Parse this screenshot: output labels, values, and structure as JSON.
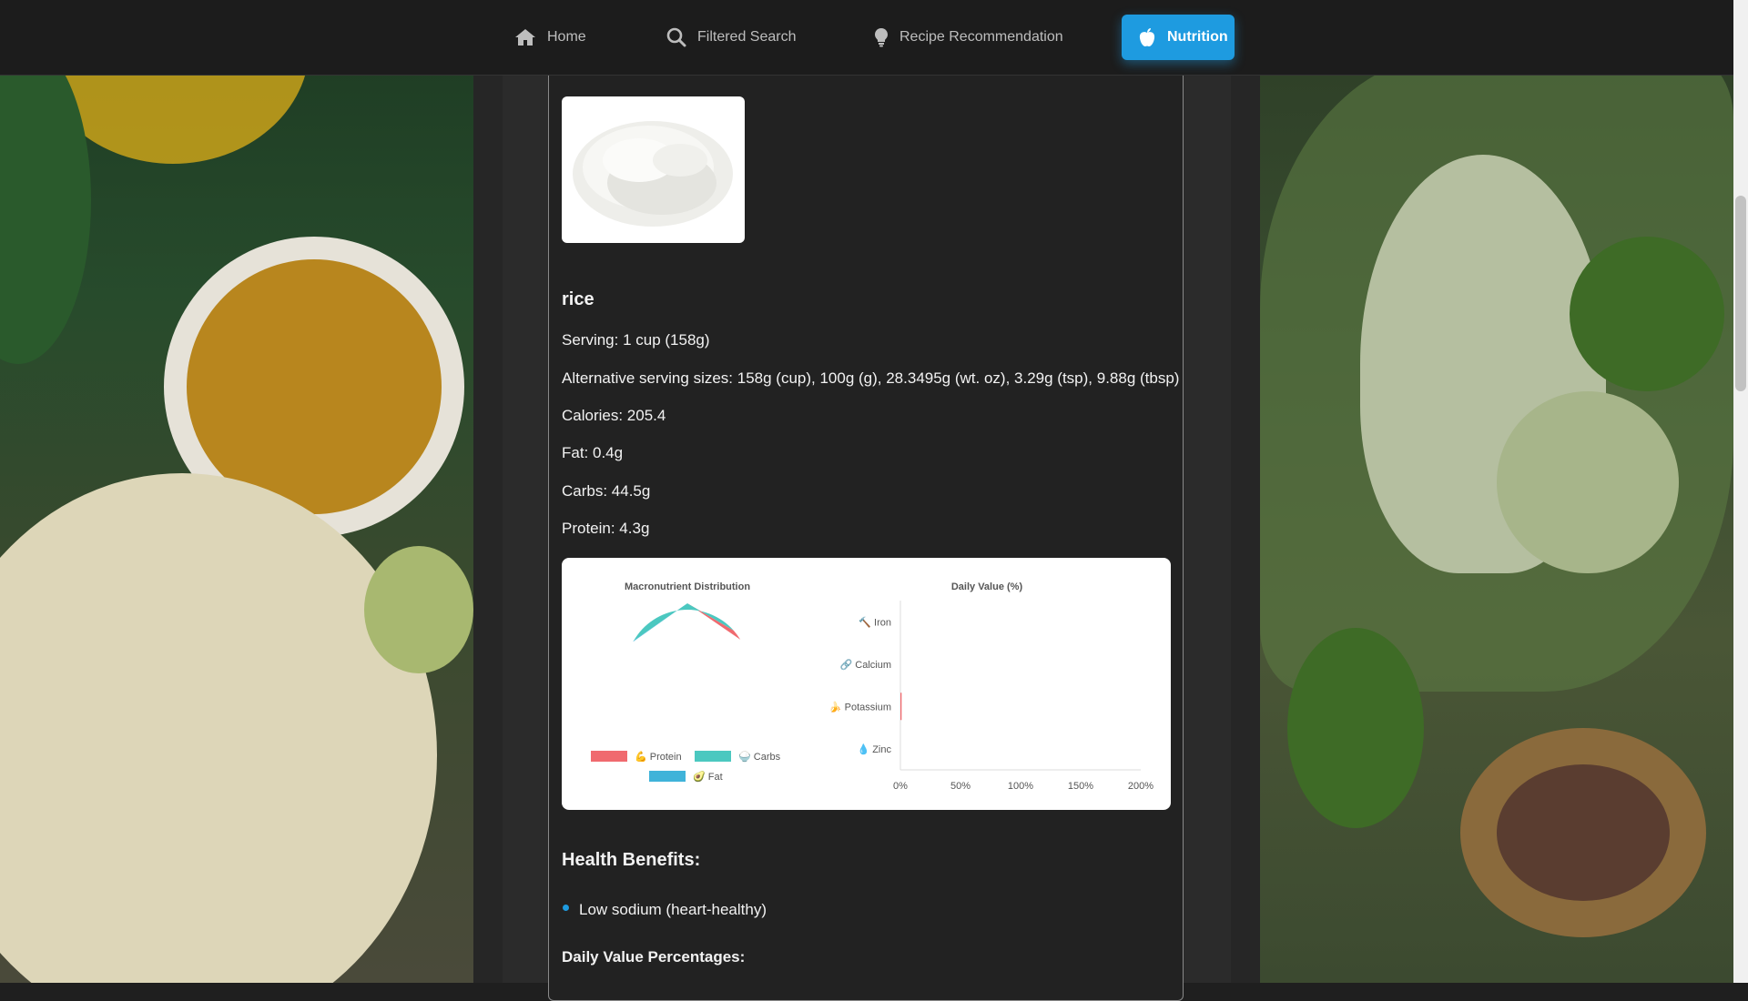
{
  "nav": {
    "items": [
      {
        "label": "Home",
        "icon": "home-icon"
      },
      {
        "label": "Filtered Search",
        "icon": "search-icon"
      },
      {
        "label": "Recipe Recommendation",
        "icon": "lightbulb-icon"
      },
      {
        "label": "Nutrition",
        "icon": "apple-icon",
        "active": true
      }
    ],
    "active_color": "#1e9be0"
  },
  "food": {
    "name": "rice",
    "serving": "Serving: 1 cup (158g)",
    "alt_sizes": "Alternative serving sizes: 158g (cup), 100g (g), 28.3495g (wt. oz), 3.29g (tsp), 9.88g (tbsp)",
    "calories": "Calories: 205.4",
    "fat": "Fat: 0.4g",
    "carbs": "Carbs: 44.5g",
    "protein": "Protein: 4.3g"
  },
  "chart_data": [
    {
      "type": "pie",
      "title": "Macronutrient Distribution",
      "labels": [
        "💪 Protein",
        "🍚 Carbs",
        "🥑 Fat"
      ],
      "values": [
        4.3,
        44.5,
        0.4
      ],
      "colors": [
        "#f06a6f",
        "#4bc8c0",
        "#3fb3d9"
      ],
      "legend": "bottom"
    },
    {
      "type": "bar",
      "orientation": "horizontal",
      "title": "Daily Value (%)",
      "categories": [
        "🔨 Iron",
        "🔗 Calcium",
        "🍌 Potassium",
        "💧 Zinc"
      ],
      "values": [
        0,
        0,
        1,
        0
      ],
      "xlim": [
        0,
        200
      ],
      "xticks": [
        "0%",
        "50%",
        "100%",
        "150%",
        "200%"
      ],
      "bar_color": "#f06a6f"
    }
  ],
  "health": {
    "heading": "Health Benefits:",
    "benefits": [
      "Low sodium (heart-healthy)"
    ],
    "dv_heading": "Daily Value Percentages:"
  }
}
